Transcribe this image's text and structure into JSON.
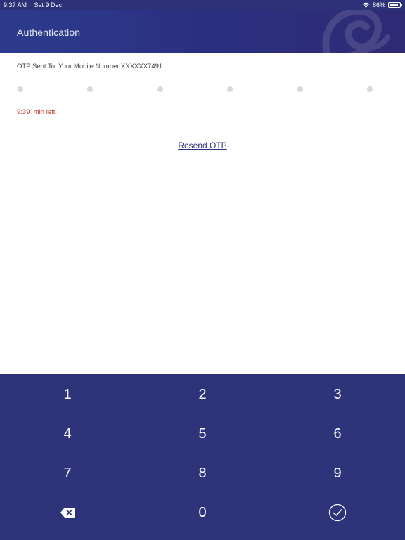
{
  "status_bar": {
    "time": "9:37 AM",
    "date": "Sat 9 Dec",
    "battery": "86%",
    "wifi_icon": "wifi-icon",
    "battery_icon": "battery-icon"
  },
  "header": {
    "title": "Authentication"
  },
  "otp": {
    "message": "OTP Sent To  Your Mobile Number XXXXXX7491",
    "digits_count_shown": 6,
    "timer_text": "9:39  min left",
    "resend_label": "Resend OTP"
  },
  "keypad": {
    "keys": [
      "1",
      "2",
      "3",
      "4",
      "5",
      "6",
      "7",
      "8",
      "9"
    ],
    "zero": "0",
    "backspace_icon": "backspace-icon",
    "confirm_icon": "check-circle-icon"
  },
  "colors": {
    "brand": "#2d3178",
    "timer": "#c0392b",
    "dot": "#d8d8d8"
  }
}
